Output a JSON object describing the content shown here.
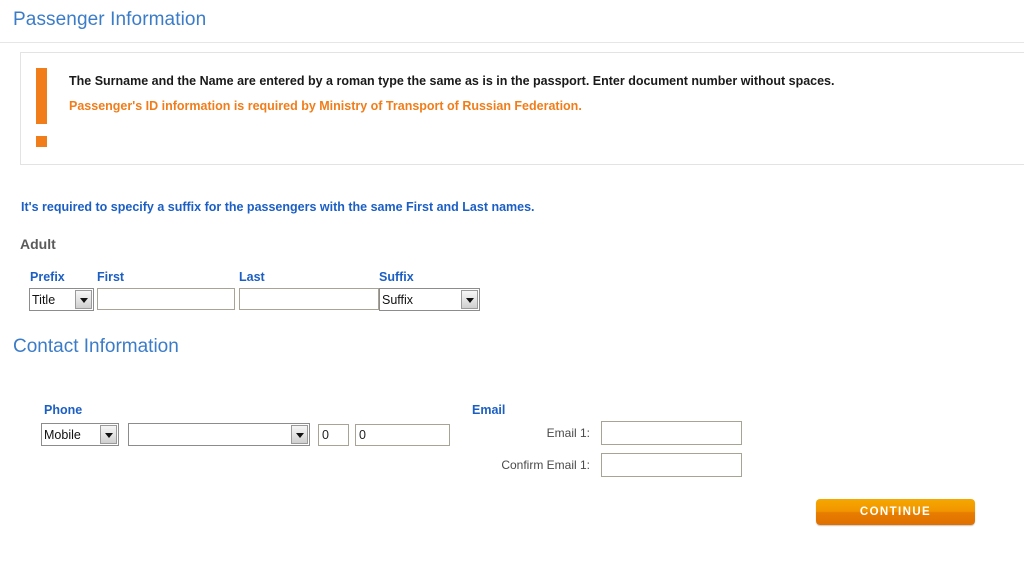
{
  "page": {
    "title": "Passenger Information"
  },
  "notice": {
    "line1": "The Surname and the Name are entered by a roman type the same as is in the passport. Enter document number without spaces.",
    "line2": "Passenger's ID information is required by Ministry of Transport of Russian Federation.",
    "icon": "exclamation-icon",
    "accent_color": "#f07d1a"
  },
  "suffix_hint": "It's required to specify a suffix for the passengers with the same First and Last names.",
  "passenger": {
    "group_label": "Adult",
    "labels": {
      "prefix": "Prefix",
      "first": "First",
      "last": "Last",
      "suffix": "Suffix"
    },
    "prefix": {
      "selected": "Title",
      "options": [
        "Title"
      ]
    },
    "first": {
      "value": "",
      "placeholder": ""
    },
    "last": {
      "value": "",
      "placeholder": ""
    },
    "suffix": {
      "selected": "Suffix",
      "options": [
        "Suffix"
      ]
    }
  },
  "contact": {
    "section_title": "Contact Information",
    "phone": {
      "label": "Phone",
      "type": {
        "selected": "Mobile",
        "options": [
          "Mobile"
        ]
      },
      "country": {
        "selected": "",
        "options": [
          ""
        ]
      },
      "area_code": "0",
      "number": "0"
    },
    "email": {
      "label": "Email",
      "email1_label": "Email 1:",
      "email1_value": "",
      "confirm1_label": "Confirm Email 1:",
      "confirm1_value": ""
    }
  },
  "actions": {
    "continue_label": "CONTINUE"
  },
  "colors": {
    "heading_blue": "#3b7cc8",
    "label_blue": "#1c5fc4",
    "accent_orange": "#f07d1a",
    "input_border": "#a8a495"
  }
}
